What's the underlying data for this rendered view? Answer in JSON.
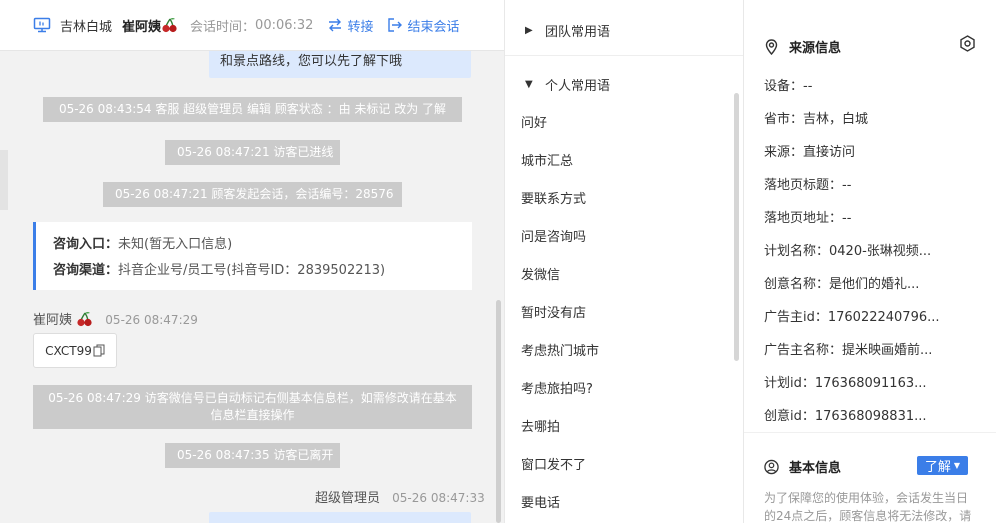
{
  "header": {
    "city": "吉林白城",
    "visitor_name": "崔阿姨",
    "time_label": "会话时间：",
    "time_value": "00:06:32",
    "transfer_label": "转接",
    "end_label": "结束会话"
  },
  "messages": {
    "bubble_top": "和景点路线，您可以先了解下哦",
    "sys_status": "05-26 08:43:54 客服 超级管理员 编辑 顾客状态 ：由 未标记 改为 了解",
    "sys_enter": "05-26 08:47:21 访客已进线",
    "sys_start": "05-26 08:47:21 顾客发起会话，会话编号：28576",
    "entry_key": "咨询入口：",
    "entry_val": "未知(暂无入口信息)",
    "channel_key": "咨询渠道：",
    "channel_val": "抖音企业号/员工号(抖音号ID：2839502213)",
    "visitor_sender": "崔阿姨",
    "visitor_time": "05-26 08:47:29",
    "visitor_code": "CXCT99",
    "sys_wechat": "05-26 08:47:29 访客微信号已自动标记右侧基本信息栏，如需修改请在基本信息栏直接操作",
    "sys_left": "05-26 08:47:35 访客已离开",
    "agent_sender": "超级管理员",
    "agent_time": "05-26 08:47:33"
  },
  "phrases": {
    "team_group": "团队常用语",
    "personal_group": "个人常用语",
    "items": [
      "问好",
      "城市汇总",
      "要联系方式",
      "问是咨询吗",
      "发微信",
      "暂时没有店",
      "考虑热门城市",
      "考虑旅拍吗?",
      "去哪拍",
      "窗口发不了",
      "要电话"
    ]
  },
  "source": {
    "title": "来源信息",
    "device": "设备：--",
    "province": "省市：吉林，白城",
    "origin": "来源：直接访问",
    "landing_title": "落地页标题：--",
    "landing_url": "落地页地址：--",
    "plan_name": "计划名称：0420-张琳视频...",
    "idea_name": "创意名称：是他们的婚礼...",
    "advertiser_id": "广告主id：176022240796...",
    "advertiser_name": "广告主名称：提米映画婚前...",
    "plan_id": "计划id：176368091163...",
    "idea_id": "创意id：176368098831..."
  },
  "basic": {
    "title": "基本信息",
    "status": "了解",
    "notice": "为了保障您的使用体验，会话发生当日的24点之后，顾客信息将无法修改，请"
  },
  "colors": {
    "accent": "#3b7ee8",
    "bubble": "#dce9fd",
    "system": "#cbcbcb",
    "chat_bg": "#f2f2f2"
  }
}
